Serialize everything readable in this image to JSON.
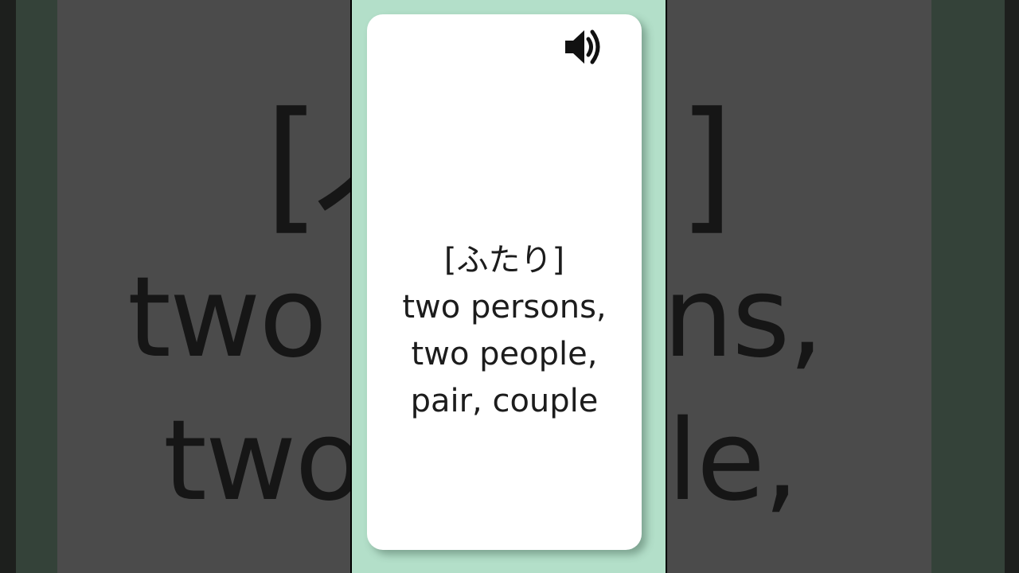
{
  "card": {
    "reading": "[ふたり]",
    "meaning_lines": [
      "two persons,",
      "two people,",
      "pair, couple"
    ],
    "audio_icon": "speaker-volume-icon"
  },
  "background": {
    "bracket_left": "[",
    "fragment_left": "ふ",
    "bracket_right": "]",
    "line1": "two persons,",
    "line2": "two people,"
  },
  "colors": {
    "phone_background": "#b3dfc9",
    "card_background": "#ffffff",
    "text": "#1c1c1c",
    "blurred_background": "#4b4b4b"
  }
}
